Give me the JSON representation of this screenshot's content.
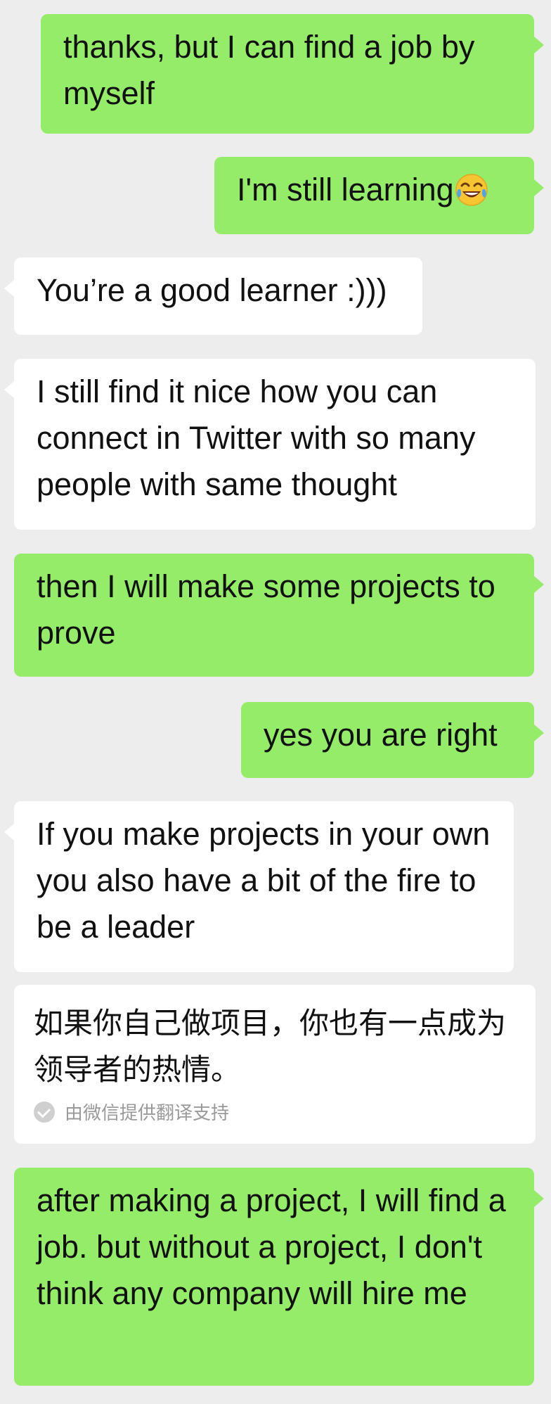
{
  "messages": [
    {
      "side": "outgoing",
      "text": "thanks, but I can find a job by myself"
    },
    {
      "side": "outgoing",
      "text": "I'm still learning",
      "emoji": "tears-of-joy-emoji"
    },
    {
      "side": "incoming",
      "text": "You’re a good learner :)))"
    },
    {
      "side": "incoming",
      "text": "I still find it nice how you can connect in Twitter with so many people with same thought"
    },
    {
      "side": "outgoing",
      "text": "then I will make some projects to prove"
    },
    {
      "side": "outgoing",
      "text": "yes you are right"
    },
    {
      "side": "incoming",
      "text": "If you make projects in your own you also have a bit of the fire to be a leader"
    },
    {
      "side": "outgoing",
      "text": "after making a project, I will find a job. but without a project, I don't think any company will hire me"
    }
  ],
  "translation": {
    "text": "如果你自己做项目，你也有一点成为领导者的热情。",
    "credit": "由微信提供翻译支持",
    "credit_icon": "check-circle-icon"
  },
  "colors": {
    "background": "#ededed",
    "outgoing_bubble": "#95ec69",
    "incoming_bubble": "#ffffff"
  }
}
